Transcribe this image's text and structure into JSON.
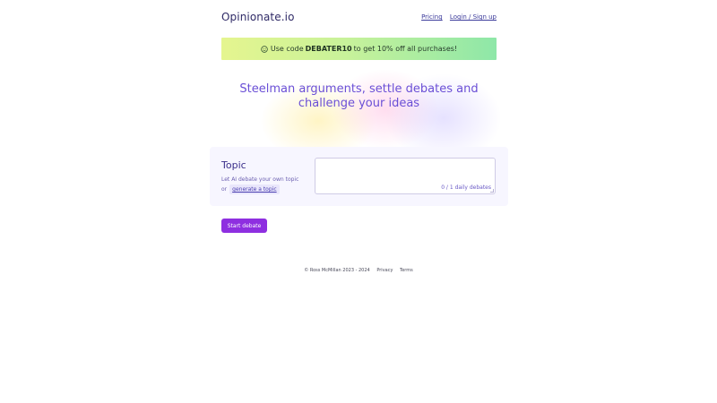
{
  "header": {
    "brand": "Opinionate.io",
    "nav": [
      {
        "label": "Pricing"
      },
      {
        "label": "Login / Sign up"
      }
    ]
  },
  "promo": {
    "prefix": "Use code",
    "code": "DEBATER10",
    "suffix": "to get 10% off all purchases!",
    "icon": "smiley-icon"
  },
  "hero": {
    "headline": "Steelman arguments, settle debates and challenge your ideas"
  },
  "topic": {
    "title": "Topic",
    "desc_line1": "Let AI debate your own topic",
    "desc_or": "or",
    "generate_label": "generate a topic",
    "input_value": "",
    "counter": "0 / 1 daily debates"
  },
  "actions": {
    "start_label": "Start debate"
  },
  "footer": {
    "copyright": "© Ross McMillan 2023 - 2024",
    "privacy": "Privacy",
    "terms": "Terms"
  },
  "colors": {
    "accent": "#8e2fe0",
    "headline": "#6a4fd6",
    "promo_start": "#e5f58f",
    "promo_end": "#8ee7a8"
  }
}
